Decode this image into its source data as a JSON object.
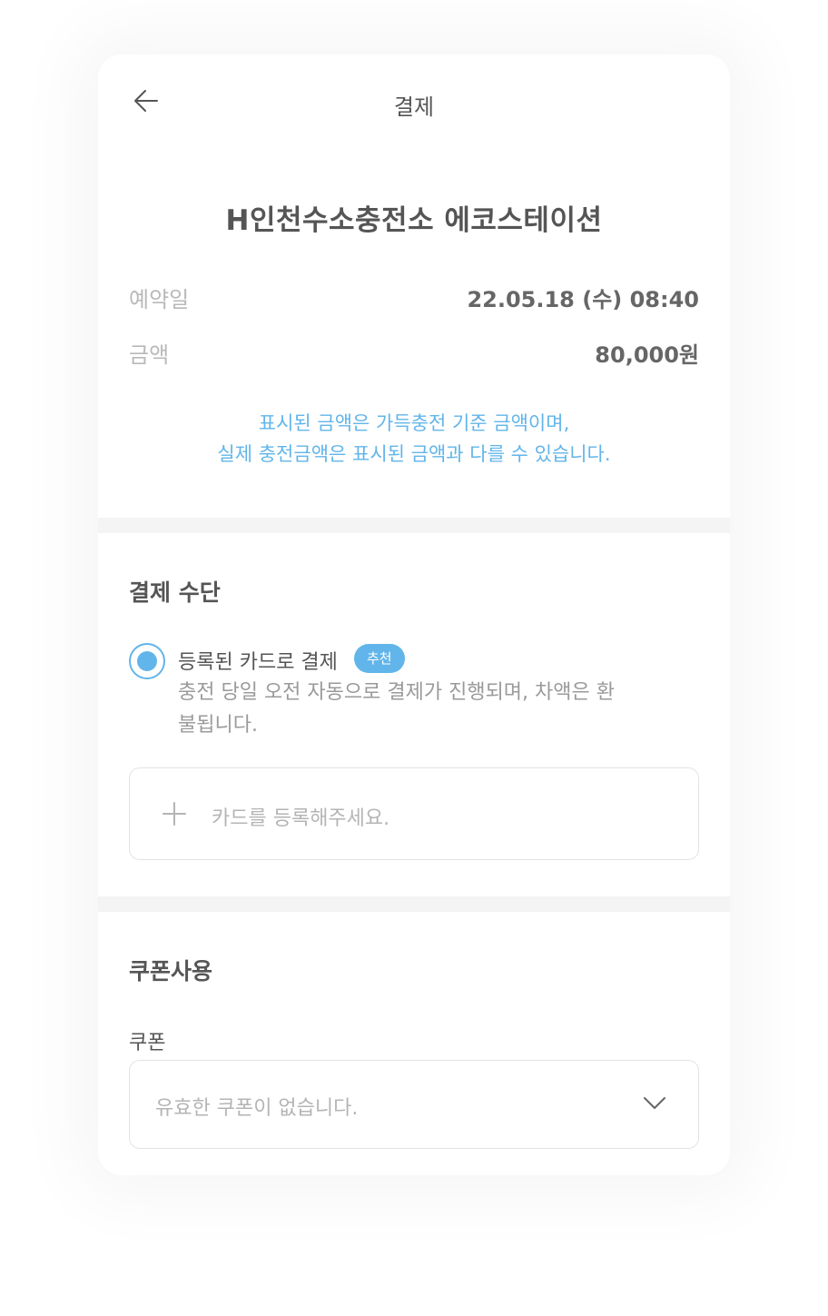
{
  "header": {
    "title": "결제",
    "back_icon": "arrow-left-icon"
  },
  "reservation": {
    "station_name": "H인천수소충전소 에코스테이션",
    "date_label": "예약일",
    "date_value": "22.05.18 (수) 08:40",
    "amount_label": "금액",
    "amount_value": "80,000원",
    "notice_line1": "표시된 금액은 가득충전 기준 금액이며,",
    "notice_line2": "실제 충전금액은 표시된 금액과 다를 수 있습니다."
  },
  "payment": {
    "section_title": "결제 수단",
    "option_label": "등록된 카드로 결제",
    "option_selected": true,
    "badge": "추천",
    "option_desc": "충전 당일 오전 자동으로 결제가 진행되며, 차액은 환불됩니다.",
    "add_card_text": "카드를 등록해주세요.",
    "add_card_icon": "plus-icon"
  },
  "coupon": {
    "section_title": "쿠폰사용",
    "label": "쿠폰",
    "select_text": "유효한 쿠폰이 없습니다.",
    "select_icon": "chevron-down-icon"
  },
  "colors": {
    "accent": "#62b5ea",
    "text_primary": "#555555",
    "text_muted": "#b9b9b9",
    "background": "#f4f4f4"
  }
}
